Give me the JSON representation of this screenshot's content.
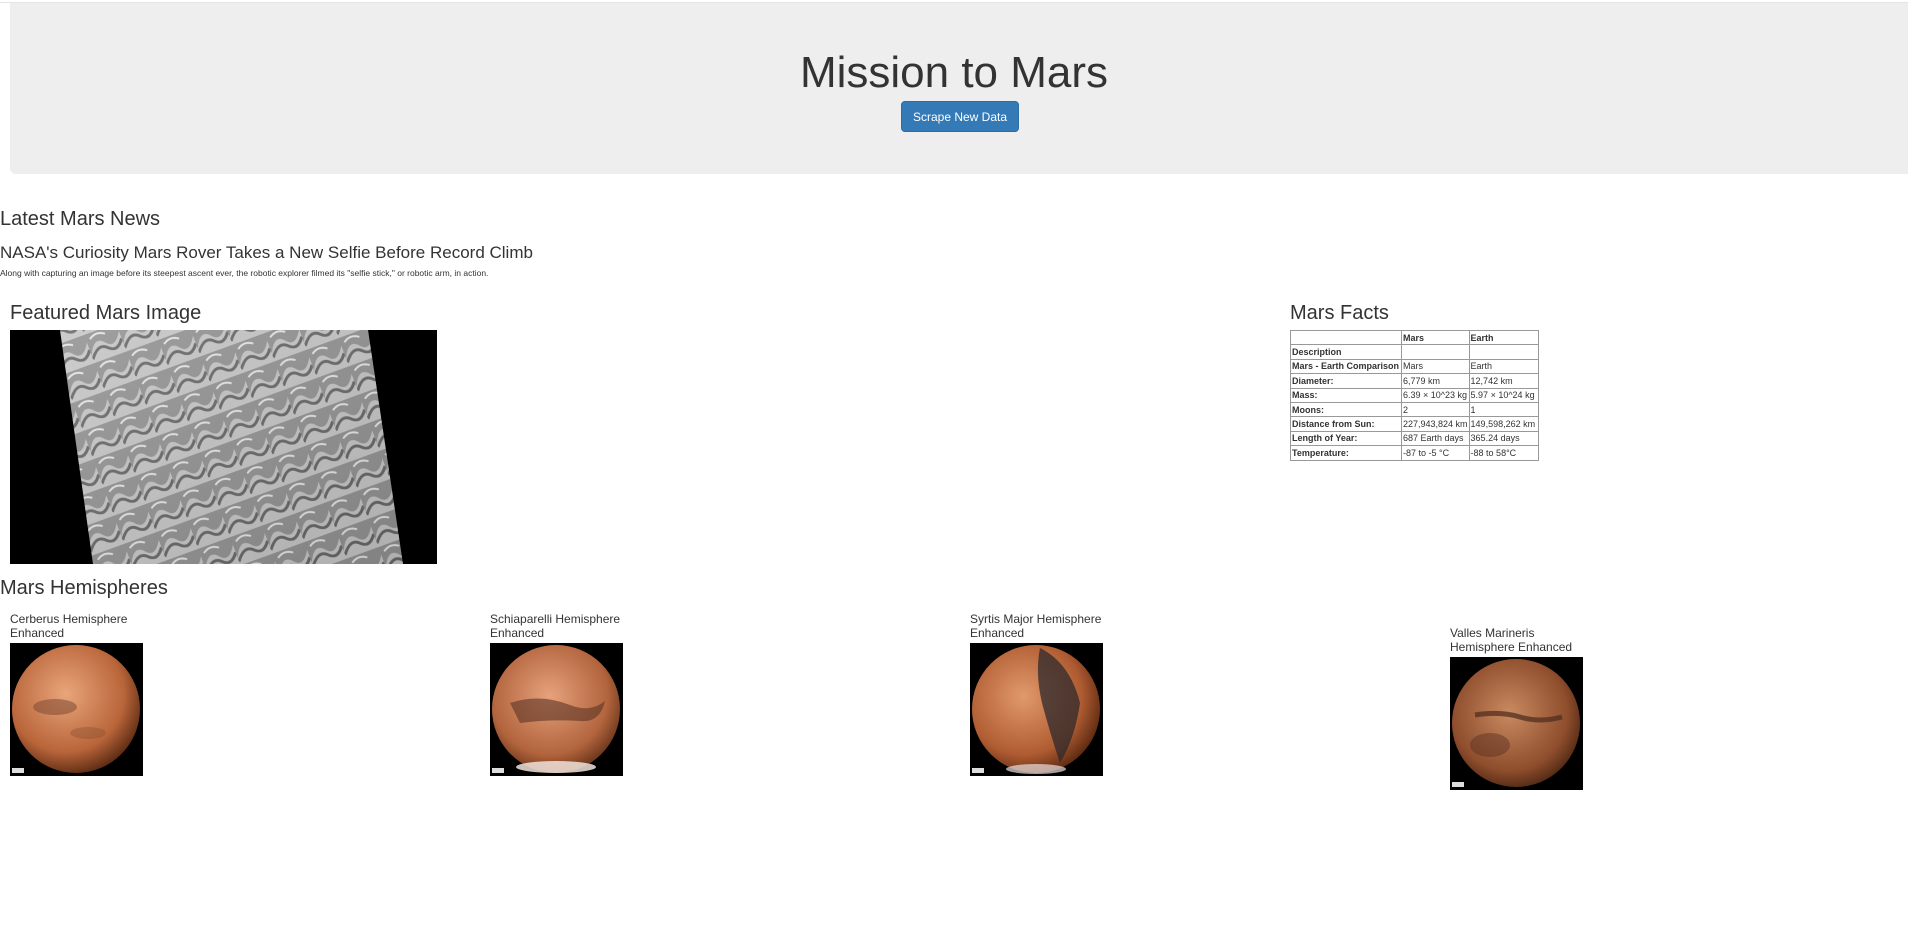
{
  "header": {
    "title": "Mission to Mars",
    "button_label": "Scrape New Data"
  },
  "news": {
    "heading": "Latest Mars News",
    "title": "NASA's Curiosity Mars Rover Takes a New Selfie Before Record Climb",
    "paragraph": "Along with capturing an image before its steepest ascent ever, the robotic explorer filmed its \"selfie stick,\" or robotic arm, in action."
  },
  "featured": {
    "heading": "Featured Mars Image",
    "image": "mars-dunes-image"
  },
  "facts": {
    "heading": "Mars Facts",
    "columns": [
      "",
      "Mars",
      "Earth"
    ],
    "index_label": "Description",
    "rows": [
      [
        "Mars - Earth Comparison",
        "Mars",
        "Earth"
      ],
      [
        "Diameter:",
        "6,779 km",
        "12,742 km"
      ],
      [
        "Mass:",
        "6.39 × 10^23 kg",
        "5.97 × 10^24 kg"
      ],
      [
        "Moons:",
        "2",
        "1"
      ],
      [
        "Distance from Sun:",
        "227,943,824 km",
        "149,598,262 km"
      ],
      [
        "Length of Year:",
        "687 Earth days",
        "365.24 days"
      ],
      [
        "Temperature:",
        "-87 to -5 °C",
        "-88 to 58°C"
      ]
    ]
  },
  "hemispheres": {
    "heading": "Mars Hemispheres",
    "items": [
      {
        "title": "Cerberus Hemisphere Enhanced"
      },
      {
        "title": "Schiaparelli Hemisphere Enhanced"
      },
      {
        "title": "Syrtis Major Hemisphere Enhanced"
      },
      {
        "title": "Valles Marineris Hemisphere Enhanced"
      }
    ]
  }
}
